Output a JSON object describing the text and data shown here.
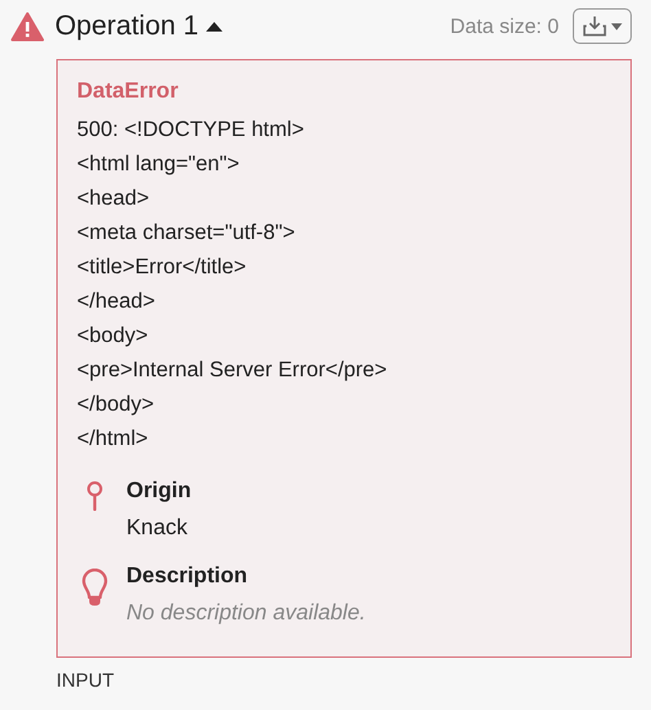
{
  "operation": {
    "title": "Operation 1",
    "expanded": true,
    "data_size": "Data size: 0"
  },
  "error": {
    "type": "DataError",
    "lines": [
      "500: <!DOCTYPE html>",
      "<html lang=\"en\">",
      "<head>",
      "<meta charset=\"utf-8\">",
      "<title>Error</title>",
      "</head>",
      "<body>",
      "<pre>Internal Server Error</pre>",
      "</body>",
      "</html>"
    ],
    "origin": {
      "label": "Origin",
      "value": "Knack"
    },
    "description": {
      "label": "Description",
      "placeholder": "No description available."
    }
  },
  "next_section": "INPUT"
}
